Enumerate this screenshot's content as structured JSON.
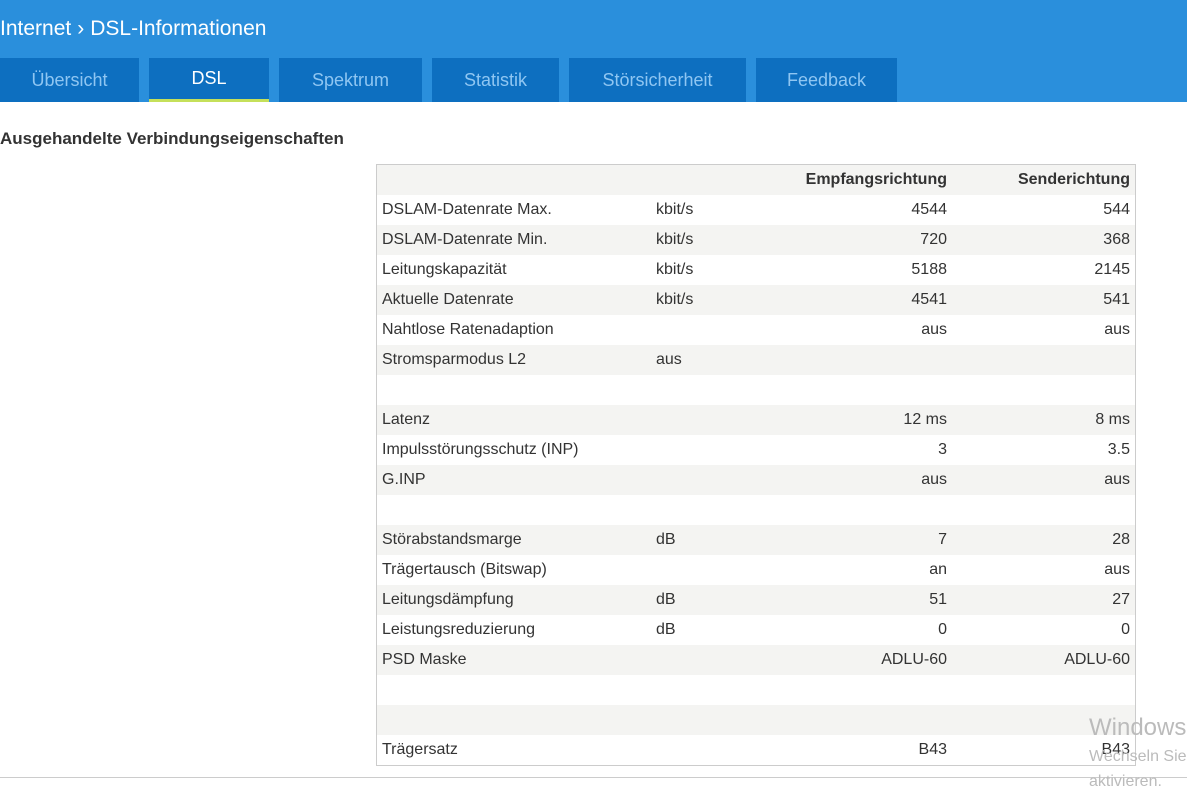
{
  "breadcrumb": {
    "parent": "Internet",
    "separator": "›",
    "current": "DSL-Informationen"
  },
  "tabs": [
    {
      "label": "Übersicht"
    },
    {
      "label": "DSL"
    },
    {
      "label": "Spektrum"
    },
    {
      "label": "Statistik"
    },
    {
      "label": "Störsicherheit"
    },
    {
      "label": "Feedback"
    }
  ],
  "section_title": "Ausgehandelte Verbindungseigenschaften",
  "table": {
    "headers": [
      "",
      "",
      "Empfangsrichtung",
      "Senderichtung"
    ],
    "rows": [
      [
        "DSLAM-Datenrate Max.",
        "kbit/s",
        "4544",
        "544"
      ],
      [
        "DSLAM-Datenrate Min.",
        "kbit/s",
        "720",
        "368"
      ],
      [
        "Leitungskapazität",
        "kbit/s",
        "5188",
        "2145"
      ],
      [
        "Aktuelle Datenrate",
        "kbit/s",
        "4541",
        "541"
      ],
      [
        "Nahtlose Ratenadaption",
        "",
        "aus",
        "aus"
      ],
      [
        "Stromsparmodus L2",
        "aus",
        "",
        ""
      ],
      [
        "",
        "",
        "",
        ""
      ],
      [
        "Latenz",
        "",
        "12 ms",
        "8 ms"
      ],
      [
        "Impulsstörungsschutz (INP)",
        "",
        "3",
        "3.5"
      ],
      [
        "G.INP",
        "",
        "aus",
        "aus"
      ],
      [
        "",
        "",
        "",
        ""
      ],
      [
        "Störabstandsmarge",
        "dB",
        "7",
        "28"
      ],
      [
        "Trägertausch (Bitswap)",
        "",
        "an",
        "aus"
      ],
      [
        "Leitungsdämpfung",
        "dB",
        "51",
        "27"
      ],
      [
        "Leistungsreduzierung",
        "dB",
        "0",
        "0"
      ],
      [
        "PSD Maske",
        "",
        "ADLU-60",
        "ADLU-60"
      ],
      [
        "",
        "",
        "",
        ""
      ],
      [
        "",
        "",
        "",
        ""
      ],
      [
        "Trägersatz",
        "",
        "B43",
        "B43"
      ]
    ]
  },
  "watermark": {
    "line1": "Windows",
    "line2": "Wechseln Sie",
    "line3": "aktivieren."
  }
}
